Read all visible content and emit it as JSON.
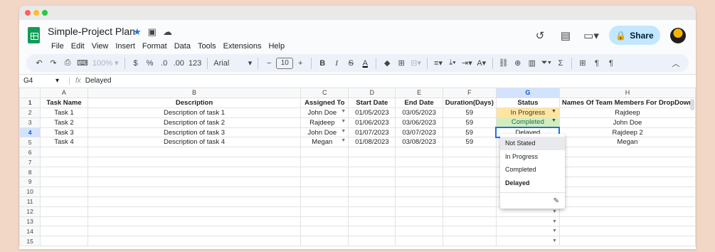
{
  "app": {
    "title": "Simple-Project Plan",
    "menu": [
      "File",
      "Edit",
      "View",
      "Insert",
      "Format",
      "Data",
      "Tools",
      "Extensions",
      "Help"
    ],
    "share_label": "Share"
  },
  "toolbar": {
    "zoom": "100%",
    "currency": "$",
    "percent": "%",
    "dec_decrease": ".0",
    "dec_increase": ".00",
    "number_format": "123",
    "font": "Arial",
    "font_size": "10",
    "minus": "−",
    "plus": "+",
    "bold": "B",
    "italic": "I",
    "strike": "S",
    "text_color": "A"
  },
  "formula_bar": {
    "cell_ref": "G4",
    "fx": "fx",
    "value": "Delayed"
  },
  "grid": {
    "columns": [
      "A",
      "B",
      "C",
      "D",
      "E",
      "F",
      "G",
      "H"
    ],
    "headers": [
      "Task Name",
      "Description",
      "Assigned To",
      "Start Date",
      "End Date",
      "Duration(Days)",
      "Status",
      "Names Of Team Members For DropDown"
    ],
    "rows": [
      [
        "Task 1",
        "Description of task 1",
        "John Doe",
        "01/05/2023",
        "03/05/2023",
        "59",
        "In Progress",
        "Rajdeep"
      ],
      [
        "Task 2",
        "Description of task 2",
        "Rajdeep",
        "01/06/2023",
        "03/06/2023",
        "59",
        "Completed",
        "John Doe"
      ],
      [
        "Task 3",
        "Description of task 3",
        "John Doe",
        "01/07/2023",
        "03/07/2023",
        "59",
        "Delayed",
        "Rajdeep 2"
      ],
      [
        "Task 4",
        "Description of task 4",
        "Megan",
        "01/08/2023",
        "03/08/2023",
        "59",
        "",
        "Megan"
      ]
    ],
    "row_numbers": [
      "1",
      "2",
      "3",
      "4",
      "5",
      "6",
      "7",
      "8",
      "9",
      "10",
      "11",
      "12",
      "13",
      "14",
      "15"
    ]
  },
  "dropdown": {
    "options": [
      "Not Stated",
      "In Progress",
      "Completed",
      "Delayed"
    ]
  },
  "colors": {
    "in_progress_bg": "#ffe5a0",
    "completed_bg": "#d4edbc",
    "selection_blue": "#1a73e8",
    "share_bg": "#c2e7ff"
  }
}
